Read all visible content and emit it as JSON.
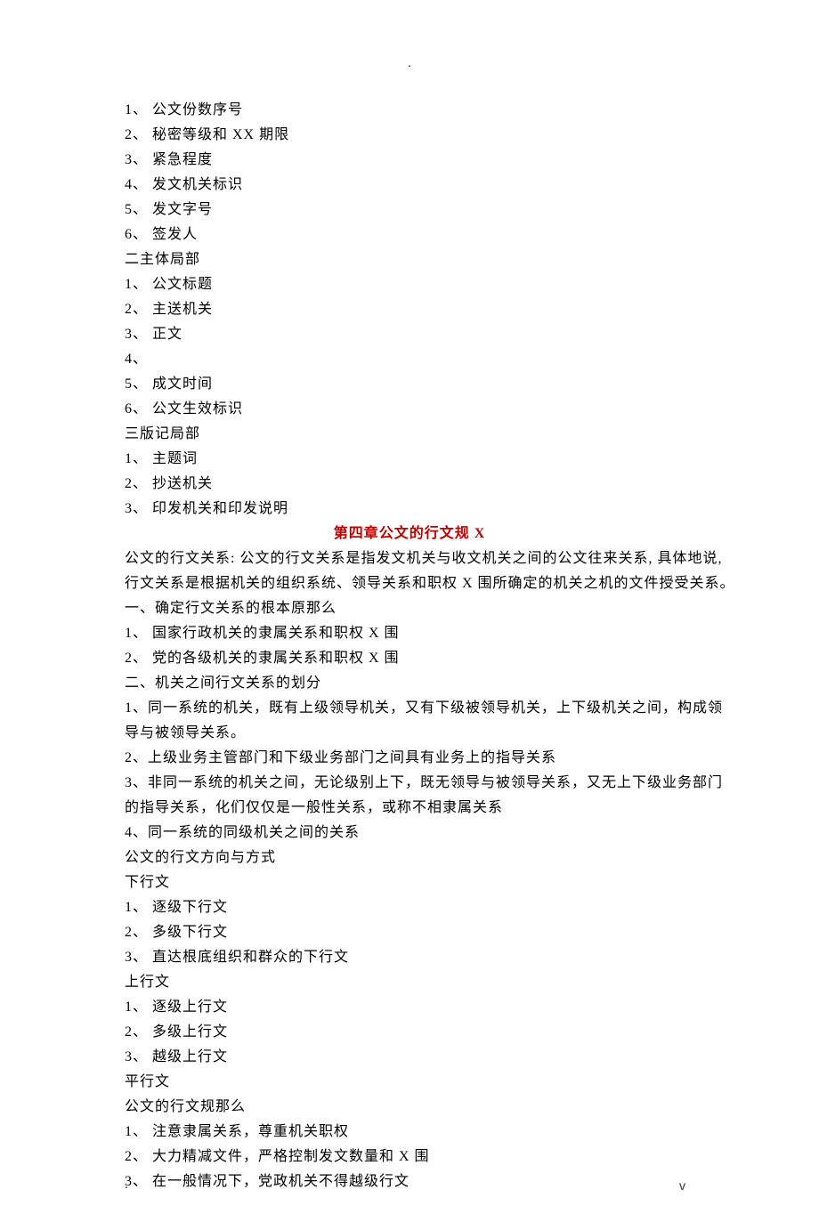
{
  "header_mark": ".",
  "footer_mark": ".",
  "page_number": "v",
  "lines": [
    "1、 公文份数序号",
    "2、 秘密等级和 XX 期限",
    "3、 紧急程度",
    "4、 发文机关标识",
    "5、 发文字号",
    "6、 签发人",
    "二主体局部",
    "1、 公文标题",
    "2、 主送机关",
    "3、 正文",
    "4、",
    "5、 成文时间",
    "6、 公文生效标识",
    "三版记局部",
    "1、 主题词",
    "2、 抄送机关",
    "3、 印发机关和印发说明"
  ],
  "chapter_title": "第四章公文的行文规 X",
  "body_lines": [
    "公文的行文关系: 公文的行文关系是指发文机关与收文机关之间的公文往来关系, 具体地说,",
    "行文关系是根据机关的组织系统、领导关系和职权 X 围所确定的机关之机的文件授受关系。",
    "一、确定行文关系的根本原那么",
    "1、 国家行政机关的隶属关系和职权 X 围",
    "2、 党的各级机关的隶属关系和职权 X 围",
    "二、机关之间行文关系的划分",
    "1、同一系统的机关，既有上级领导机关，又有下级被领导机关，上下级机关之间，构成领",
    "导与被领导关系。",
    "2、上级业务主管部门和下级业务部门之间具有业务上的指导关系",
    "3、非同一系统的机关之间，无论级别上下，既无领导与被领导关系，又无上下级业务部门",
    "的指导关系，化们仅仅是一般性关系，或称不相隶属关系",
    "4、同一系统的同级机关之间的关系",
    "公文的行文方向与方式",
    "下行文",
    "1、 逐级下行文",
    "2、 多级下行文",
    "3、 直达根底组织和群众的下行文",
    "上行文",
    "1、 逐级上行文",
    "2、 多级上行文",
    "3、 越级上行文",
    "平行文",
    "公文的行文规那么",
    "1、 注意隶属关系，尊重机关职权",
    "2、 大力精减文件，严格控制发文数量和 X 围",
    "3、 在一般情况下，党政机关不得越级行文"
  ]
}
